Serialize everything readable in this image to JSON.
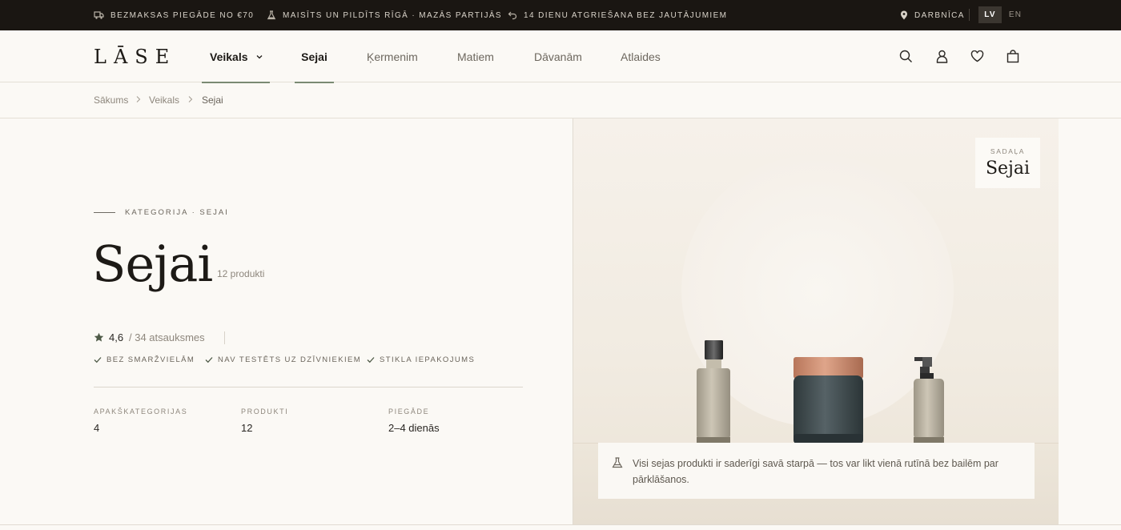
{
  "announcements": [
    {
      "icon": "truck-icon",
      "text": "BEZMAKSAS PIEGĀDE NO €70"
    },
    {
      "icon": "flask-icon",
      "text": "MAISĪTS UN PILDĪTS RĪGĀ · MAZĀS PARTIJĀS"
    },
    {
      "icon": "return-arrow-icon",
      "text": "14 DIENU ATGRIEŠANA BEZ JAUTĀJUMIEM"
    }
  ],
  "workshop": {
    "icon": "location-pin-icon",
    "label": "DARBNĪCA"
  },
  "languages": {
    "active": "LV",
    "other": "EN"
  },
  "logo": "LĀSE",
  "nav": {
    "shop": "Veikals",
    "face": "Sejai",
    "body": "Ķermenim",
    "hair": "Matiem",
    "gifts": "Dāvanām",
    "sale": "Atlaides"
  },
  "header_icons": [
    "search-icon",
    "user-icon",
    "heart-icon",
    "bag-icon"
  ],
  "breadcrumb": {
    "home": "Sākums",
    "shop": "Veikals",
    "current": "Sejai"
  },
  "hero": {
    "eyebrow": "KATEGORIJA · SEJAI",
    "title": "Sejai",
    "count": "12 produkti",
    "rating": "4,6",
    "reviews": "/ 34 atsauksmes",
    "features": [
      "BEZ SMARŽVIELĀM",
      "NAV TESTĒTS UZ DZĪVNIEKIEM",
      "STIKLA IEPAKOJUMS"
    ]
  },
  "stats": [
    {
      "label": "APAKŠKATEGORIJAS",
      "value": "4"
    },
    {
      "label": "PRODUKTI",
      "value": "12"
    },
    {
      "label": "PIEGĀDE",
      "value": "2–4 dienās"
    }
  ],
  "panel": {
    "tag_label": "SADAĻA",
    "tag_value": "Sejai",
    "note": "Visi sejas produkti ir saderīgi savā starpā — tos var likt vienā rutīnā bez bailēm par pārklāšanos."
  },
  "colors": {
    "topbar": "#1a1612",
    "accent_underline": "#7a8a73",
    "background": "#fbf9f5",
    "jar_body": "#3f4a4d",
    "jar_lid": "#c58466",
    "bottle": "#b5ae9e"
  }
}
